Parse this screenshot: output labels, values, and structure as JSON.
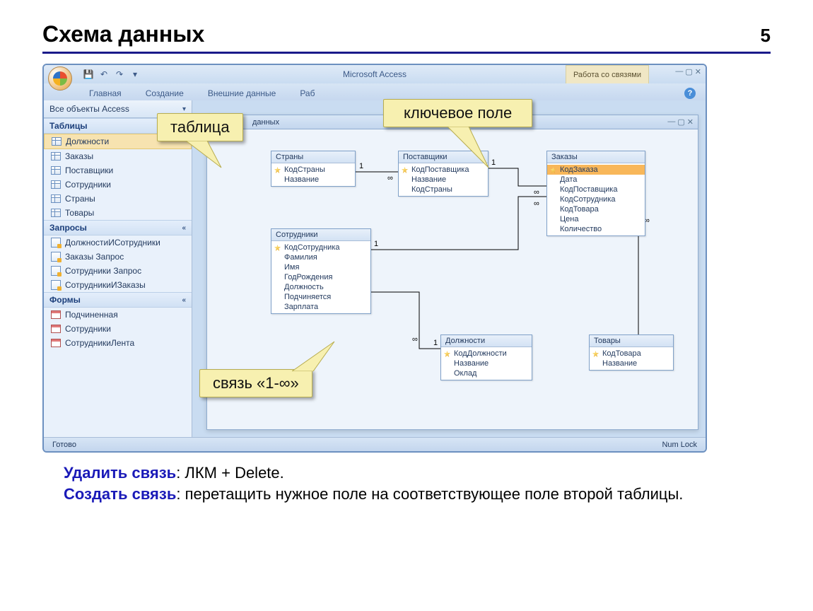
{
  "slide": {
    "title": "Схема данных",
    "number": "5"
  },
  "window": {
    "app_title": "Microsoft Access",
    "context_tab": "Работа со связями",
    "ribbon_tabs": [
      "Главная",
      "Создание",
      "Внешние данные",
      "Раб"
    ],
    "nav_header": "Все объекты Access",
    "nav_groups": {
      "tables_label": "Таблицы",
      "tables": [
        "Должности",
        "Заказы",
        "Поставщики",
        "Сотрудники",
        "Страны",
        "Товары"
      ],
      "queries_label": "Запросы",
      "queries": [
        "ДолжностиИСотрудники",
        "Заказы Запрос",
        "Сотрудники Запрос",
        "СотрудникиИЗаказы"
      ],
      "forms_label": "Формы",
      "forms": [
        "Подчиненная",
        "Сотрудники",
        "СотрудникиЛента"
      ]
    },
    "inner_title": "данных",
    "status_left": "Готово",
    "status_right": "Num Lock"
  },
  "entities": {
    "countries": {
      "title": "Страны",
      "key": "КодСтраны",
      "fields": [
        "Название"
      ]
    },
    "suppliers": {
      "title": "Поставщики",
      "key": "КодПоставщика",
      "fields": [
        "Название",
        "КодСтраны"
      ]
    },
    "orders": {
      "title": "Заказы",
      "key": "КодЗаказа",
      "fields": [
        "Дата",
        "КодПоставщика",
        "КодСотрудника",
        "КодТовара",
        "Цена",
        "Количество"
      ]
    },
    "employees": {
      "title": "Сотрудники",
      "key": "КодСотрудника",
      "fields": [
        "Фамилия",
        "Имя",
        "ГодРождения",
        "Должность",
        "Подчиняется",
        "Зарплата"
      ]
    },
    "positions": {
      "title": "Должности",
      "key": "КодДолжности",
      "fields": [
        "Название",
        "Оклад"
      ]
    },
    "goods": {
      "title": "Товары",
      "key": "КодТовара",
      "fields": [
        "Название"
      ]
    }
  },
  "rel_marks": {
    "one": "1",
    "many": "∞"
  },
  "callouts": {
    "table": "таблица",
    "keyfield": "ключевое поле",
    "relation": "связь «1-∞»"
  },
  "footer": {
    "delete_label": "Удалить связь",
    "delete_text": ": ЛКМ + Delete.",
    "create_label": "Создать связь",
    "create_text": ": перетащить нужное поле на соответствующее поле второй таблицы."
  }
}
